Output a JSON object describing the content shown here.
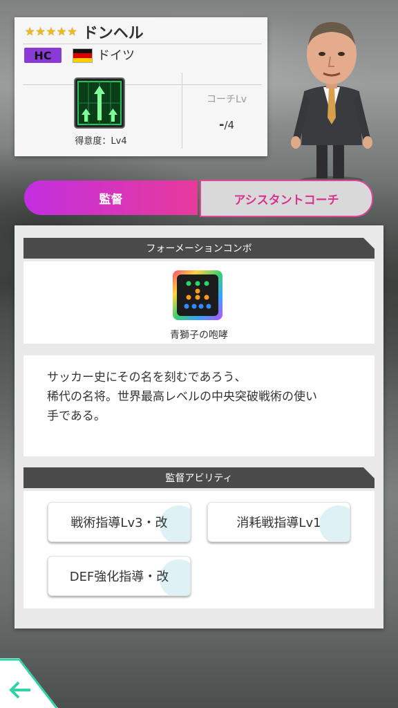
{
  "coach": {
    "stars": [
      "★",
      "★",
      "★",
      "★",
      "★"
    ],
    "name": "ドンヘル",
    "role_badge": "HC",
    "country": "ドイツ",
    "proficiency": "得意度：Lv4",
    "coach_lv_label": "コーチLv",
    "coach_lv_value": "-",
    "coach_lv_max": "/4"
  },
  "tabs": {
    "manager": "監督",
    "assistant": "アシスタントコーチ"
  },
  "formation_combo": {
    "header": "フォーメーションコンボ",
    "combo_name": "青獅子の咆哮"
  },
  "description": {
    "line1": "サッカー史にその名を刻むであろう、",
    "line2": "稀代の名将。世界最高レベルの中央突破戦術の使い",
    "line3": "手である。"
  },
  "abilities": {
    "header": "監督アビリティ",
    "items": [
      {
        "label": "戦術指導Lv3・改"
      },
      {
        "label": "消耗戦指導Lv1"
      },
      {
        "label": "DEF強化指導・改"
      }
    ]
  },
  "icons": {
    "back": "back-arrow-icon",
    "formation": "formation-icon",
    "combo": "formation-combo-icon",
    "flag": "germany-flag-icon"
  },
  "colors": {
    "tab_active_start": "#c12fe0",
    "tab_active_end": "#e83a9b",
    "tab_inactive_text": "#d6338f",
    "badge": "#8a3bd6",
    "star": "#f1b91b",
    "section_header": "#4a4a4a",
    "back_accent": "#2fd3a8"
  }
}
